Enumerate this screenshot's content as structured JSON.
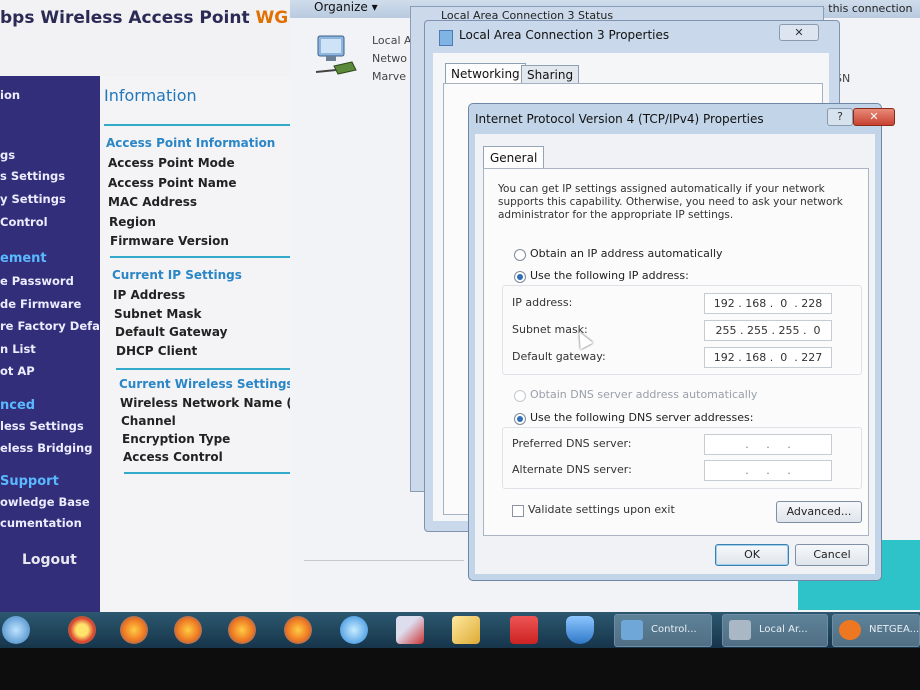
{
  "router": {
    "title_left": "bps Wireless Access Point ",
    "title_right": "WG",
    "nav": [
      "ion",
      "gs",
      "s Settings",
      "y Settings",
      " Control",
      "ement",
      "e Password",
      "de Firmware",
      "re Factory Default",
      "n List",
      "ot AP",
      "nced",
      "less Settings",
      "eless Bridging",
      " Support",
      "owledge Base",
      "cumentation",
      "Logout"
    ],
    "info_title": "Information",
    "sections": {
      "ap_info": "Access Point Information",
      "ip_settings": "Current IP Settings",
      "wireless": "Current Wireless Settings"
    },
    "ap_rows": [
      "Access Point Mode",
      "Access Point Name",
      "MAC Address",
      "Region",
      "Firmware Version"
    ],
    "ip_rows": [
      "IP Address",
      "Subnet Mask",
      "Default Gateway",
      "DHCP Client"
    ],
    "wireless_rows": [
      "Wireless Network Name (SSID)",
      "Channel",
      "Encryption Type",
      "Access Control"
    ]
  },
  "explorer": {
    "organize": "Organize ▾",
    "conn_lines": [
      "Local A",
      "Netwo",
      "Marve"
    ],
    "right_text": "e this connection",
    "sn": "SN"
  },
  "status_dialog": {
    "title": "Local Area Connection 3 Status"
  },
  "props_dialog": {
    "title": "Local Area Connection 3 Properties",
    "close": "✕",
    "tabs": [
      "Networking",
      "Sharing"
    ],
    "stub": "C"
  },
  "ipv4": {
    "title": "Internet Protocol Version 4 (TCP/IPv4) Properties",
    "help": "?",
    "close": "✕",
    "tab": "General",
    "description": "You can get IP settings assigned automatically if your network supports this capability. Otherwise, you need to ask your network administrator for the appropriate IP settings.",
    "obtain_ip_auto": "Obtain an IP address automatically",
    "use_following_ip": "Use the following IP address:",
    "ip_label": "IP address:",
    "ip_value": "192 . 168 .  0  . 228",
    "mask_label": "Subnet mask:",
    "mask_value": "255 . 255 . 255 .  0",
    "gateway_label": "Default gateway:",
    "gateway_value": "192 . 168 .  0  . 227",
    "obtain_dns_auto": "Obtain DNS server address automatically",
    "use_following_dns": "Use the following DNS server addresses:",
    "pref_dns_label": "Preferred DNS server:",
    "pref_dns_value": "  .     .     .  ",
    "alt_dns_label": "Alternate DNS server:",
    "alt_dns_value": "  .     .     .  ",
    "validate": "Validate settings upon exit",
    "advanced": "Advanced...",
    "ok": "OK",
    "cancel": "Cancel"
  },
  "taskbar": {
    "tasks": [
      "Control...",
      "Local Ar...",
      "NETGEA..."
    ],
    "icon_colors": [
      "#3a7fc0",
      "#dd4433",
      "#ee7722",
      "#ee7722",
      "#ee7722",
      "#ee7722",
      "#2a88dd",
      "#cc3333",
      "#ddaa33",
      "#dd3333",
      "#2f78c8"
    ]
  }
}
